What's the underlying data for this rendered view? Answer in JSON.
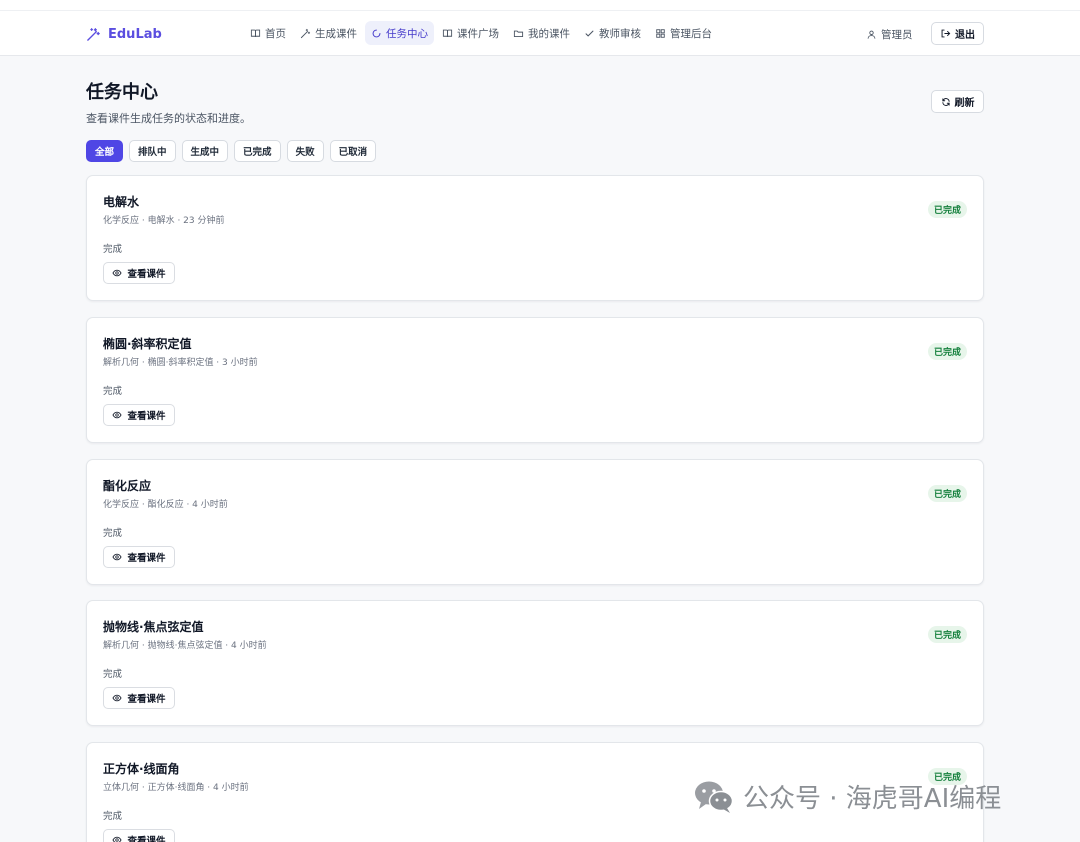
{
  "app": {
    "brand": "EduLab"
  },
  "nav": {
    "items": [
      {
        "label": "首页",
        "icon": "book-open-icon",
        "active": false
      },
      {
        "label": "生成课件",
        "icon": "magic-wand-icon",
        "active": false
      },
      {
        "label": "任务中心",
        "icon": "loader-icon",
        "active": true
      },
      {
        "label": "课件广场",
        "icon": "book-open-icon",
        "active": false
      },
      {
        "label": "我的课件",
        "icon": "folder-icon",
        "active": false
      },
      {
        "label": "教师审核",
        "icon": "check-icon",
        "active": false
      },
      {
        "label": "管理后台",
        "icon": "grid-icon",
        "active": false
      }
    ],
    "user_label": "管理员",
    "logout_label": "退出"
  },
  "page": {
    "title": "任务中心",
    "subtitle": "查看课件生成任务的状态和进度。",
    "refresh_label": "刷新"
  },
  "filters": [
    {
      "label": "全部",
      "active": true
    },
    {
      "label": "排队中",
      "active": false
    },
    {
      "label": "生成中",
      "active": false
    },
    {
      "label": "已完成",
      "active": false
    },
    {
      "label": "失败",
      "active": false
    },
    {
      "label": "已取消",
      "active": false
    }
  ],
  "tasks": [
    {
      "title": "电解水",
      "meta": "化学反应 · 电解水 · 23 分钟前",
      "status": "完成",
      "badge": "已完成",
      "action": "查看课件"
    },
    {
      "title": "椭圆·斜率积定值",
      "meta": "解析几何 · 椭圆·斜率积定值 · 3 小时前",
      "status": "完成",
      "badge": "已完成",
      "action": "查看课件"
    },
    {
      "title": "酯化反应",
      "meta": "化学反应 · 酯化反应 · 4 小时前",
      "status": "完成",
      "badge": "已完成",
      "action": "查看课件"
    },
    {
      "title": "抛物线·焦点弦定值",
      "meta": "解析几何 · 抛物线·焦点弦定值 · 4 小时前",
      "status": "完成",
      "badge": "已完成",
      "action": "查看课件"
    },
    {
      "title": "正方体·线面角",
      "meta": "立体几何 · 正方体·线面角 · 4 小时前",
      "status": "完成",
      "badge": "已完成",
      "action": "查看课件"
    }
  ],
  "watermark": {
    "text": "公众号 · 海虎哥AI编程"
  },
  "colors": {
    "accent": "#4f46e5",
    "brand": "#5b4ee0",
    "success_bg": "#e7f5ea",
    "success_text": "#15803d"
  }
}
